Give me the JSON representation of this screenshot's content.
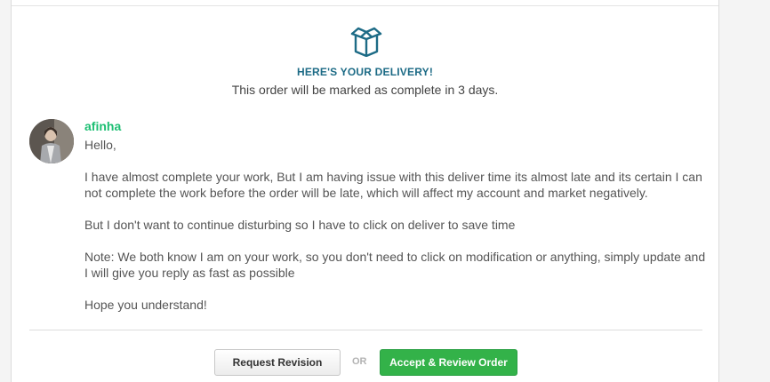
{
  "delivery": {
    "icon": "open-box-icon",
    "title": "HERE'S YOUR DELIVERY!",
    "subtitle": "This order will be marked as complete in 3 days."
  },
  "message": {
    "sender": "afinha",
    "avatar": "seller-avatar",
    "paragraphs": [
      "Hello,",
      "I have almost complete your work, But I am having issue with this deliver time its almost late and its certain I can not complete the work before the order will be late, which will affect my account and market negatively.",
      "But I don't want to continue disturbing so I have to click on deliver to save time",
      "Note: We both know I am on your work, so you don't need to click on modification or anything, simply update and I will give you reply as fast as possible",
      "Hope you understand!"
    ]
  },
  "actions": {
    "request_revision": "Request Revision",
    "or": "OR",
    "accept": "Accept & Review Order"
  },
  "colors": {
    "accent_teal": "#1d6b86",
    "sender_green": "#1dbf73",
    "accept_green": "#33b249"
  }
}
